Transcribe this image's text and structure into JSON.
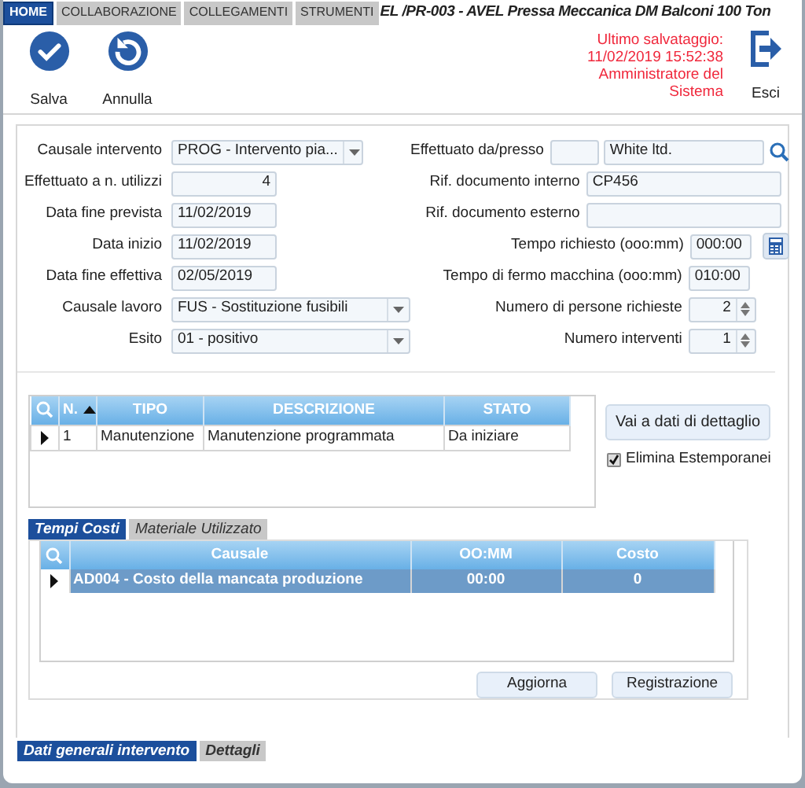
{
  "top_tabs": [
    {
      "label": "HOME",
      "selected": true
    },
    {
      "label": "COLLABORAZIONE",
      "selected": false
    },
    {
      "label": "COLLEGAMENTI",
      "selected": false
    },
    {
      "label": "STRUMENTI",
      "selected": false
    }
  ],
  "window_title": "EL /PR-003 - AVEL Pressa Meccanica DM Balconi 100 Ton",
  "toolbar": [
    {
      "kind": "save",
      "label": "Salva"
    },
    {
      "kind": "undo",
      "label": "Annulla"
    }
  ],
  "save_info": "Ultimo salvataggio:\n11/02/2019 15:52:38\nAmministratore del\nSistema",
  "exit_button": {
    "label": "Esci"
  },
  "left_fields": [
    {
      "label": "Causale intervento",
      "kind": "select",
      "value": "PROG - Intervento pia..."
    },
    {
      "label": "Effettuato a n. utilizzi",
      "kind": "number",
      "value": "4"
    },
    {
      "label": "Data fine prevista",
      "kind": "date",
      "value": "11/02/2019"
    },
    {
      "label": "Data inizio",
      "kind": "date",
      "value": "11/02/2019"
    },
    {
      "label": "Data fine effettiva",
      "kind": "date",
      "value": "02/05/2019"
    },
    {
      "label": "Causale lavoro",
      "kind": "wideselect",
      "value": "FUS - Sostituzione fusibili"
    },
    {
      "label": "Esito",
      "kind": "wideselect",
      "value": "01 - positivo"
    }
  ],
  "right_fields": [
    {
      "label": "Effettuato da/presso",
      "kind": "lookup",
      "value": "White ltd."
    },
    {
      "label": "Rif. documento interno",
      "kind": "text",
      "value": "CP456"
    },
    {
      "label": "Rif. documento esterno",
      "kind": "text"
    },
    {
      "label": "Tempo richiesto (ooo:mm)",
      "kind": "time_calc",
      "value": "000:00"
    },
    {
      "label": "Tempo di fermo macchina (ooo:mm)",
      "kind": "time",
      "value": "010:00"
    },
    {
      "label": "Numero di persone richieste",
      "kind": "spinner",
      "value": "2"
    },
    {
      "label": "Numero interventi",
      "kind": "spinner",
      "value": "1"
    }
  ],
  "activities_table": {
    "columns": [
      "N.",
      "TIPO",
      "DESCRIZIONE",
      "STATO"
    ],
    "rows": [
      {
        "cells": [
          "1",
          "Manutenzione",
          "Manutenzione programmata",
          "Da iniziare"
        ],
        "selected": false
      }
    ]
  },
  "detail_button": {
    "label": "Vai a dati di dettaglio"
  },
  "remove_option": {
    "label": "Elimina Estemporanei",
    "checked": true
  },
  "inner_tabs": [
    {
      "label": "Tempi Costi",
      "selected": true
    },
    {
      "label": "Materiale Utilizzato",
      "selected": false
    }
  ],
  "costs_table": {
    "columns": [
      "Causale",
      "OO:MM",
      "Costo"
    ],
    "rows": [
      {
        "cells": [
          "AD004 - Costo della mancata produzione",
          "00:00",
          "0"
        ],
        "selected": true
      }
    ]
  },
  "cost_buttons": [
    "Aggiorna",
    "Registrazione"
  ],
  "bottom_tabs": [
    {
      "label": "Dati generali intervento",
      "selected": true
    },
    {
      "label": "Dettagli",
      "selected": false
    }
  ]
}
